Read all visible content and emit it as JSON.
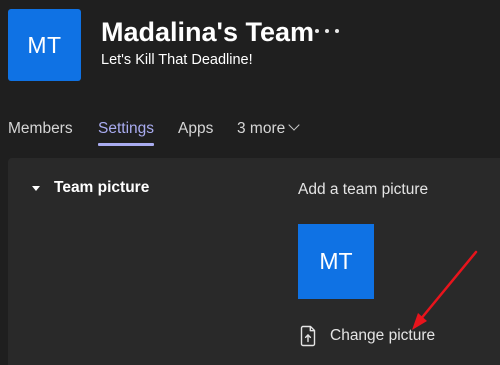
{
  "header": {
    "avatar_initials": "MT",
    "team_name": "Madalina's Team",
    "more_options_icon": "ellipsis-icon",
    "subtitle": "Let's Kill That Deadline!"
  },
  "tabs": [
    {
      "label": "Members",
      "active": false
    },
    {
      "label": "Settings",
      "active": true
    },
    {
      "label": "Apps",
      "active": false
    },
    {
      "label": "3 more",
      "active": false,
      "icon": "chevron-down-icon"
    }
  ],
  "settings": {
    "section_title": "Team picture",
    "section_expanded": true,
    "add_label": "Add a team picture",
    "preview_initials": "MT",
    "change_label": "Change picture",
    "change_icon": "upload-file-icon"
  },
  "colors": {
    "avatar": "#0f72e4",
    "active_tab": "#a9acf0",
    "annotation_arrow": "#e8141c"
  }
}
